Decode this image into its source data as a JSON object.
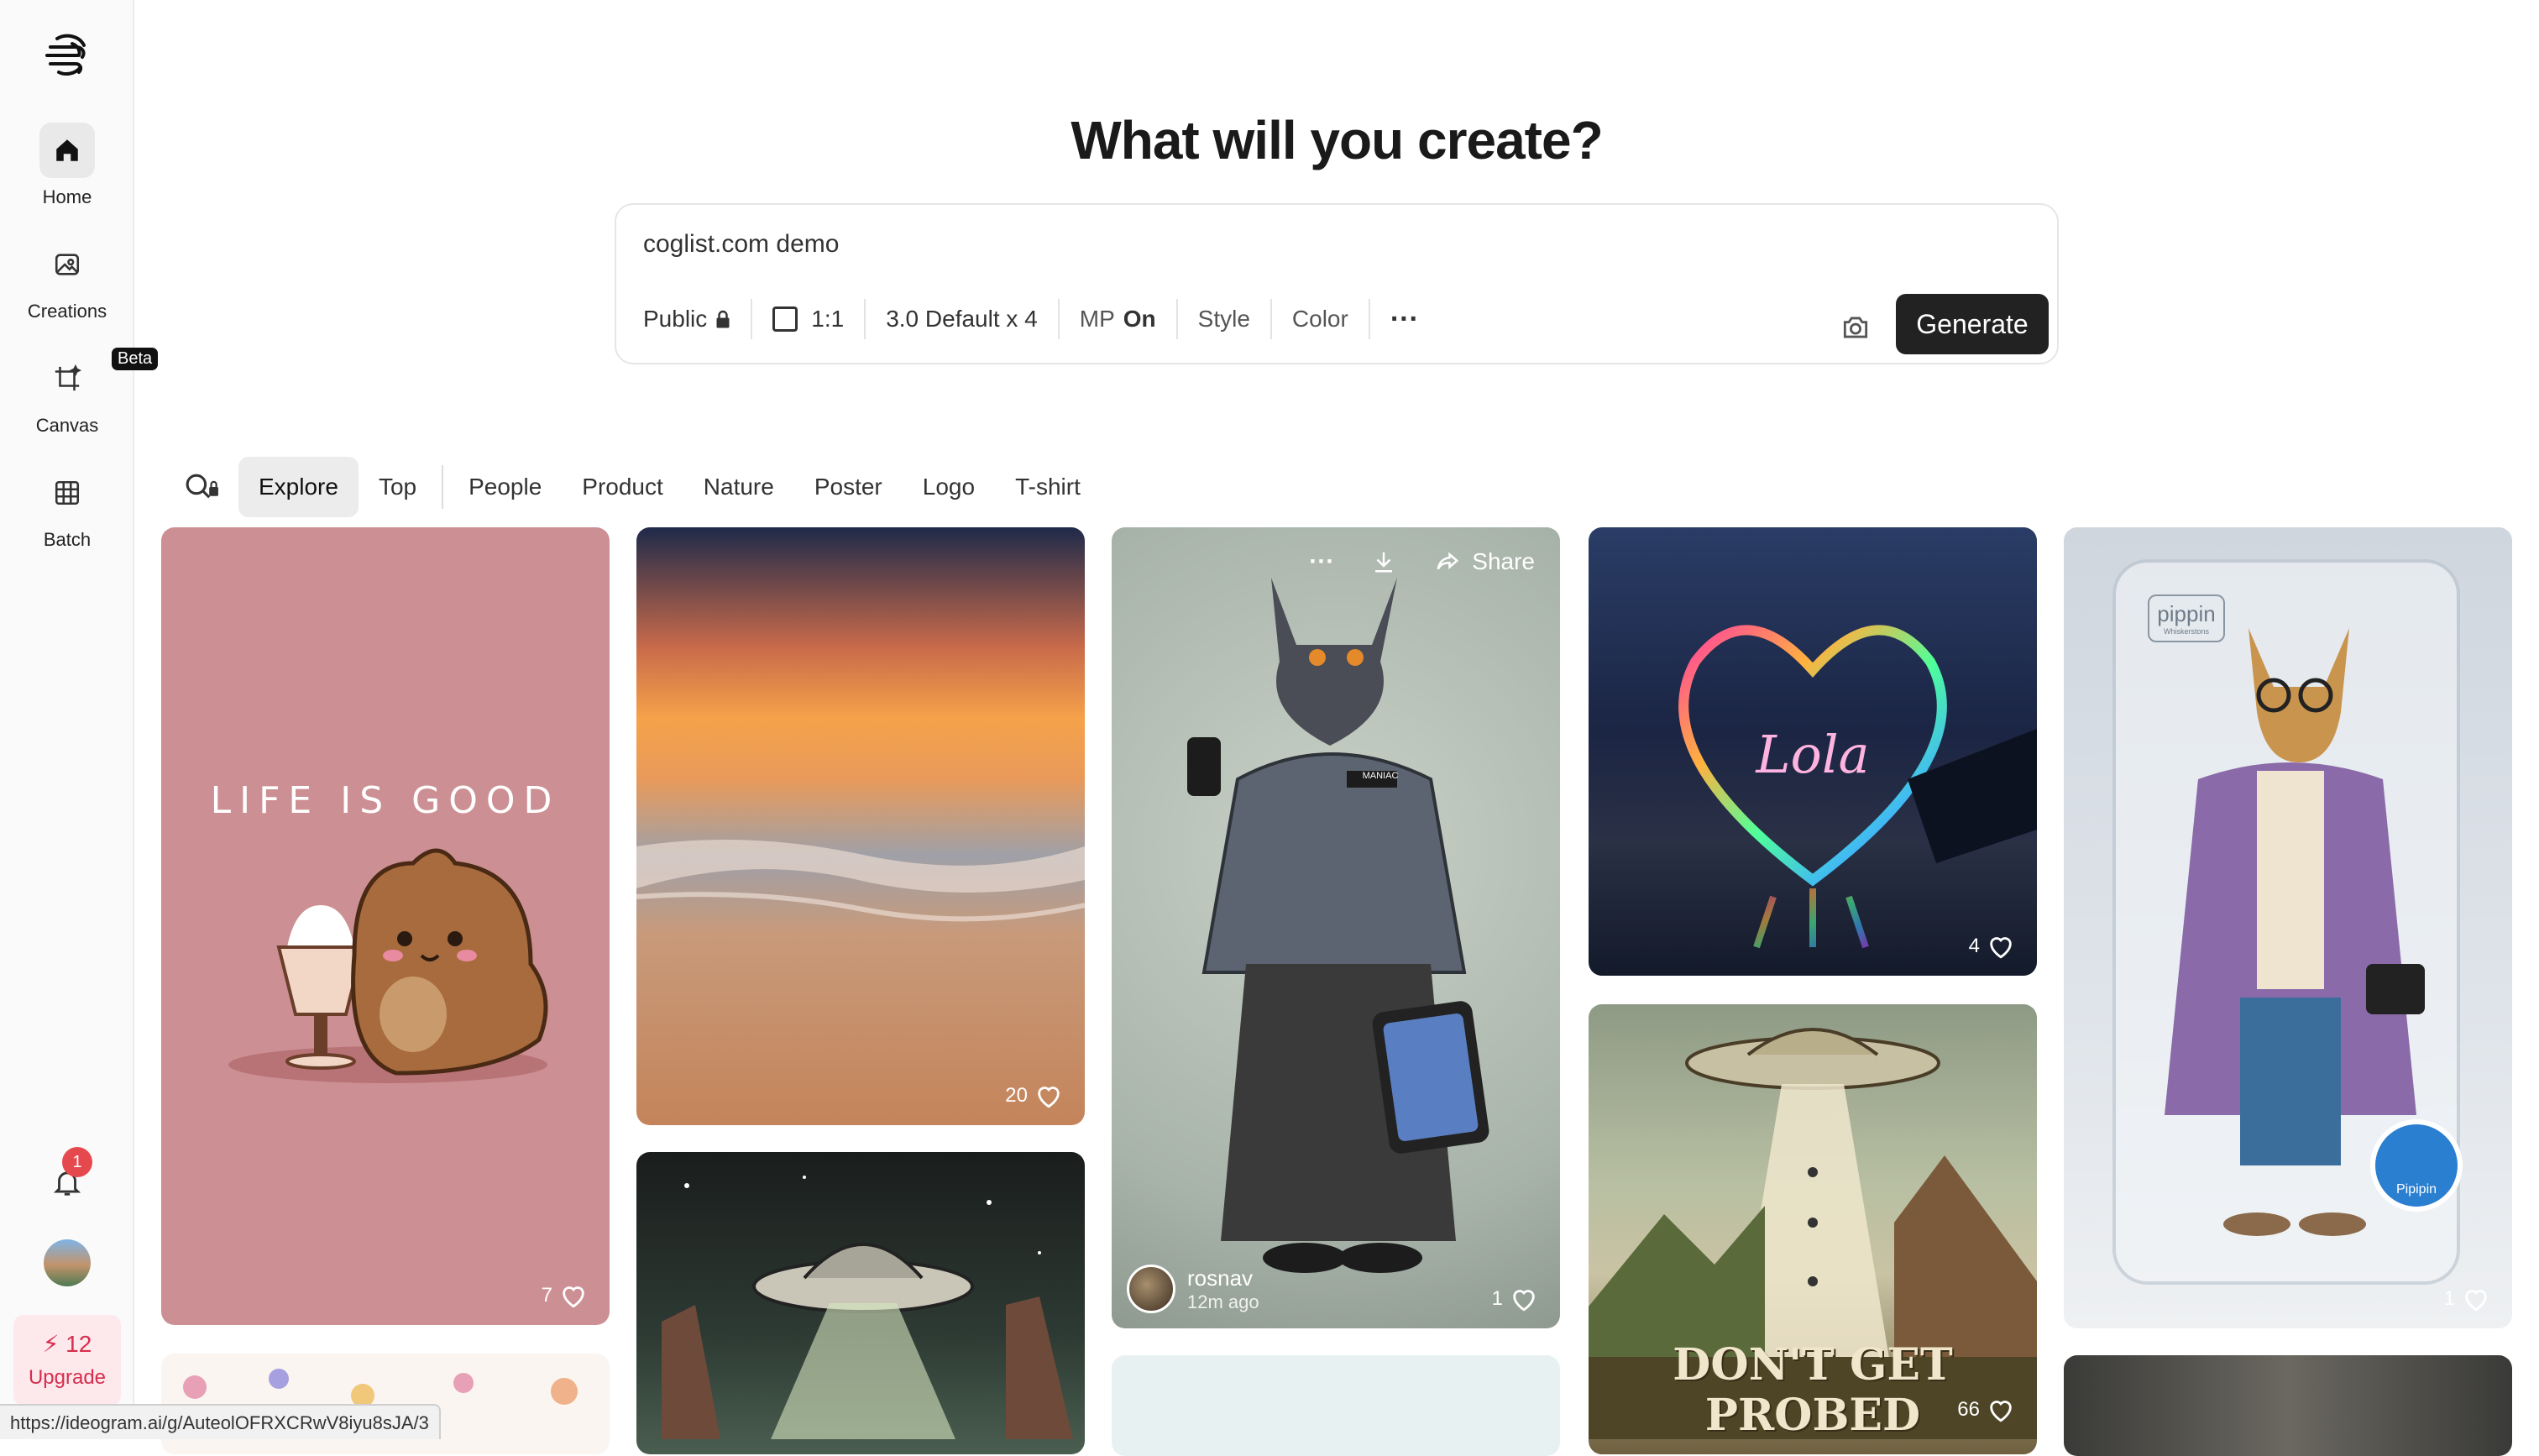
{
  "sidebar": {
    "items": [
      {
        "label": "Home",
        "icon": "home-icon",
        "active": true
      },
      {
        "label": "Creations",
        "icon": "image-icon",
        "active": false
      },
      {
        "label": "Canvas",
        "icon": "canvas-crop-icon",
        "active": false,
        "badge": "Beta"
      },
      {
        "label": "Batch",
        "icon": "grid-table-icon",
        "active": false
      }
    ],
    "notification_count": "1",
    "credits": "12",
    "upgrade_label": "Upgrade"
  },
  "header": {
    "title": "What will you create?"
  },
  "prompt": {
    "text": "coglist.com demo",
    "options": {
      "visibility": "Public",
      "aspect": "1:1",
      "model": "3.0 Default x 4",
      "mp_label": "MP",
      "mp_value": "On",
      "style": "Style",
      "color": "Color",
      "more": "···"
    },
    "generate_label": "Generate"
  },
  "filters": {
    "tabs": [
      {
        "label": "Explore",
        "active": true
      },
      {
        "label": "Top",
        "active": false
      },
      {
        "label": "People",
        "active": false
      },
      {
        "label": "Product",
        "active": false
      },
      {
        "label": "Nature",
        "active": false
      },
      {
        "label": "Poster",
        "active": false
      },
      {
        "label": "Logo",
        "active": false
      },
      {
        "label": "T-shirt",
        "active": false
      }
    ]
  },
  "gallery": {
    "cards": [
      {
        "id": "c1",
        "likes": "7",
        "art_text": "LIFE IS GOOD"
      },
      {
        "id": "c2",
        "likes": "20"
      },
      {
        "id": "c3",
        "likes": "1",
        "user": "rosnav",
        "time": "12m ago",
        "share_label": "Share",
        "badge_text": "MANIAC"
      },
      {
        "id": "c4",
        "likes": "4",
        "art_text": "Lola"
      },
      {
        "id": "c5",
        "likes": "1",
        "art_text": "pippin",
        "art_subtext": "Whiskerstons",
        "art_badge": "Pipipin"
      },
      {
        "id": "c6"
      },
      {
        "id": "c7"
      },
      {
        "id": "c8",
        "likes": "66",
        "art_text_1": "DON'T GET",
        "art_text_2": "PROBED"
      },
      {
        "id": "c9"
      },
      {
        "id": "c10"
      }
    ]
  },
  "status_url": "https://ideogram.ai/g/AuteolOFRXCRwV8iyu8sJA/3",
  "colors": {
    "accent": "#222222",
    "upgrade_bg": "#fde8ec",
    "upgrade_text": "#d62e4d",
    "badge": "#e5484d"
  }
}
